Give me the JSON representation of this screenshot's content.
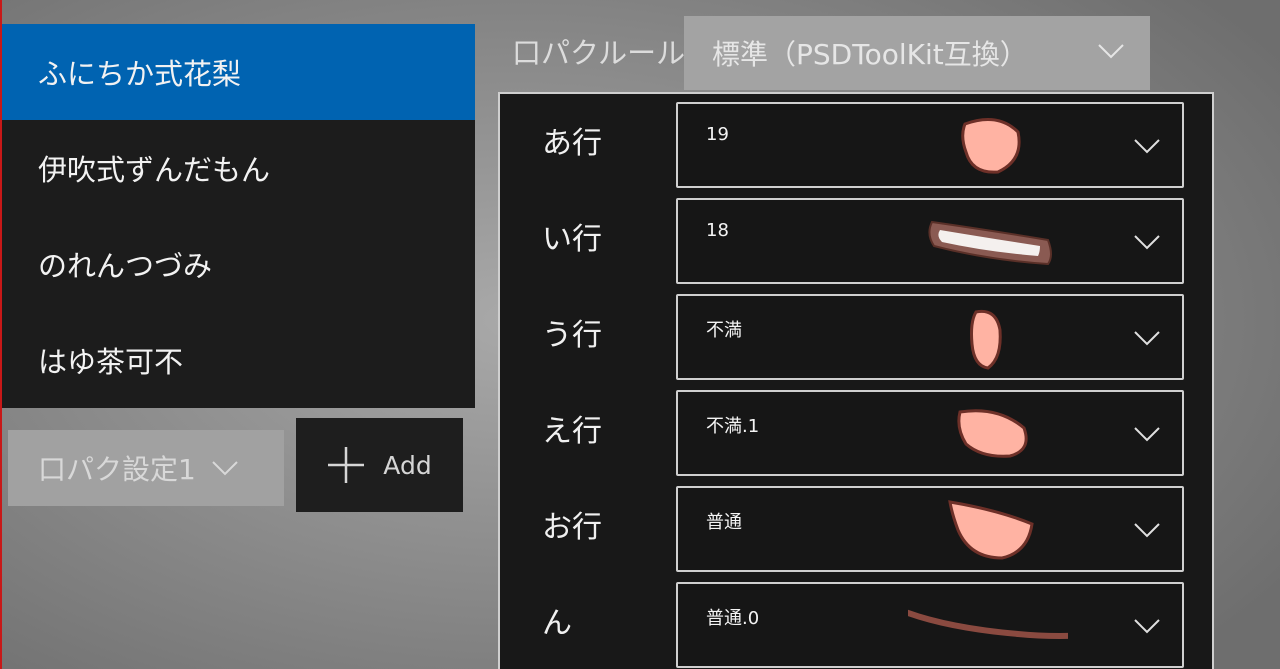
{
  "characters": [
    {
      "name": "ふにちか式花梨",
      "selected": true
    },
    {
      "name": "伊吹式ずんだもん",
      "selected": false
    },
    {
      "name": "のれんつづみ",
      "selected": false
    },
    {
      "name": "はゆ茶可不",
      "selected": false
    }
  ],
  "preset": {
    "selected": "口パク設定1"
  },
  "add_button": {
    "label": "Add"
  },
  "rule": {
    "label": "口パクルール",
    "selected": "標準（PSDToolKit互換）"
  },
  "mappings": [
    {
      "vowel": "あ行",
      "value": "19"
    },
    {
      "vowel": "い行",
      "value": "18"
    },
    {
      "vowel": "う行",
      "value": "不満"
    },
    {
      "vowel": "え行",
      "value": "不満.1"
    },
    {
      "vowel": "お行",
      "value": "普通"
    },
    {
      "vowel": "ん",
      "value": "普通.0"
    }
  ],
  "colors": {
    "selection": "#0063b1",
    "mouth_fill": "#ffb0a0",
    "mouth_outline": "#7a3a30"
  }
}
